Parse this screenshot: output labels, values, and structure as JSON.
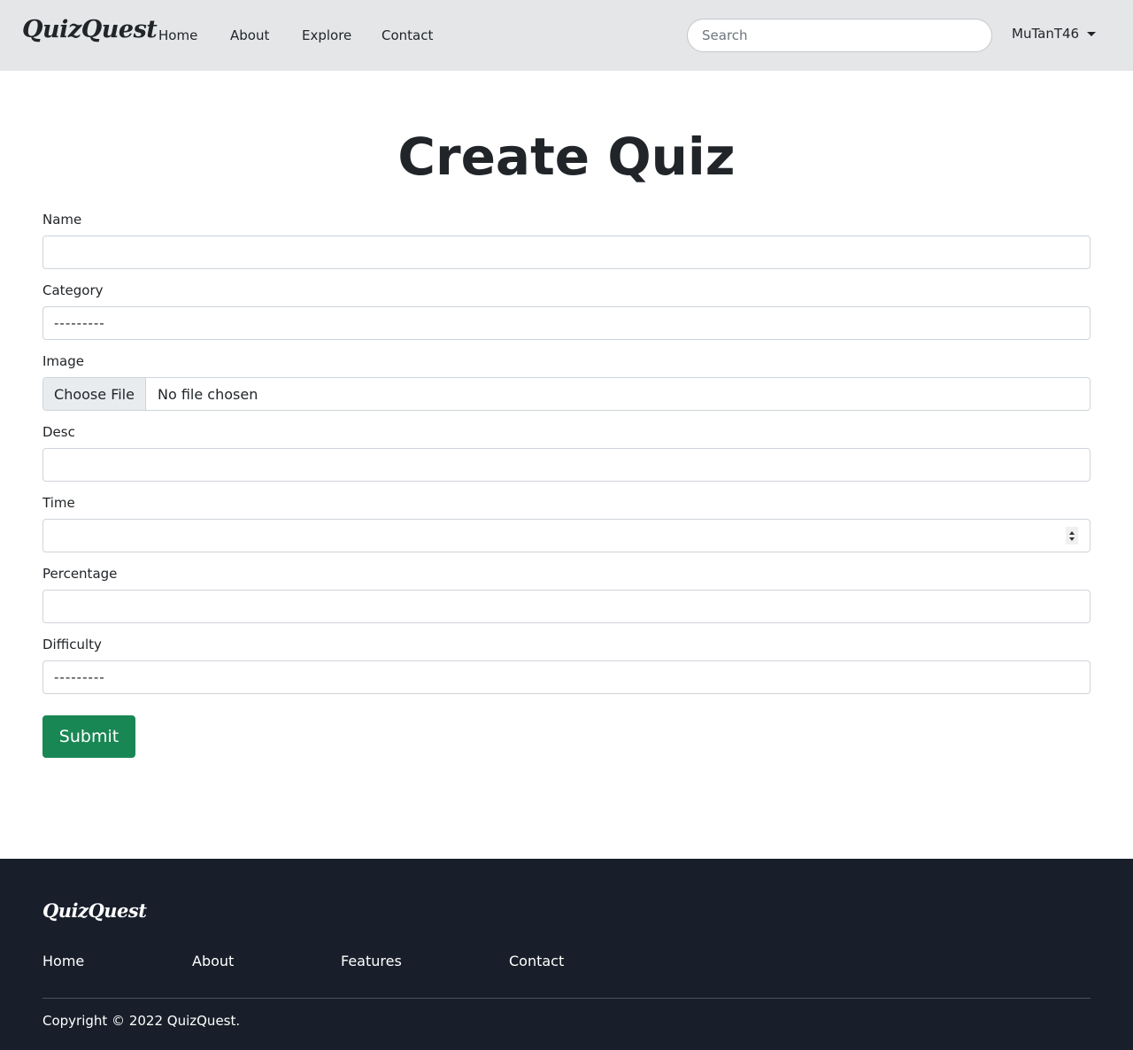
{
  "navbar": {
    "brand": "QuizQuest",
    "links": [
      "Home",
      "About",
      "Explore",
      "Contact"
    ],
    "search_placeholder": "Search",
    "user": "MuTanT46"
  },
  "main": {
    "title": "Create Quiz",
    "fields": {
      "name": {
        "label": "Name",
        "value": ""
      },
      "category": {
        "label": "Category",
        "selected": "---------"
      },
      "image": {
        "label": "Image",
        "button": "Choose File",
        "status": "No file chosen"
      },
      "desc": {
        "label": "Desc",
        "value": ""
      },
      "time": {
        "label": "Time",
        "value": ""
      },
      "percentage": {
        "label": "Percentage",
        "value": ""
      },
      "difficulty": {
        "label": "Difficulty",
        "selected": "---------"
      }
    },
    "submit": "Submit"
  },
  "footer": {
    "brand": "QuizQuest",
    "links": [
      "Home",
      "About",
      "Features",
      "Contact"
    ],
    "copyright": "Copyright © 2022 QuizQuest."
  },
  "colors": {
    "navbar_bg": "#e5e6e8",
    "primary_button": "#198754",
    "footer_bg": "#181f2a"
  }
}
